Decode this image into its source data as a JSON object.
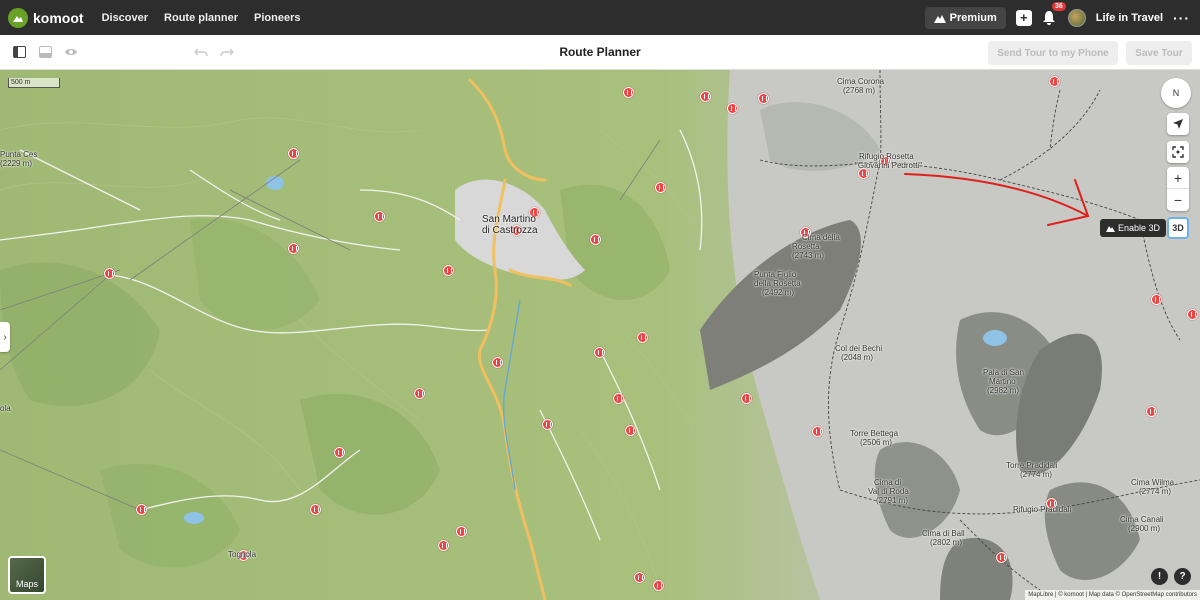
{
  "nav": {
    "logo_text": "komoot",
    "links": [
      "Discover",
      "Route planner",
      "Pioneers"
    ],
    "premium_label": "Premium",
    "notification_count": "36",
    "username": "Life in Travel",
    "more_label": "···"
  },
  "toolbar": {
    "title": "Route Planner",
    "send_label": "Send Tour to my Phone",
    "save_label": "Save Tour"
  },
  "map": {
    "scale_label": "500 m",
    "compass_label": "N",
    "zoom_in": "+",
    "zoom_out": "−",
    "enable3d_label": "Enable 3D",
    "btn3d_label": "3D",
    "maps_label": "Maps",
    "info_label": "!",
    "help_label": "?",
    "attribution": "MapLibre | © komoot | Map data © OpenStreetMap contributors",
    "labels": {
      "town": "San Martino di Castrozza",
      "town_line1": "San Martino",
      "town_line2": "di Castrozza",
      "punta_ces_name": "Punta Ces",
      "punta_ces_alt": "(2229 m)",
      "cima_corona_name": "Cima Corona",
      "cima_corona_alt": "(2768 m)",
      "rifugio_rosetta_line1": "Rifugio Rosetta",
      "rifugio_rosetta_line2": "\"Giovanni Pedrotti\"",
      "cima_rosetta_line1": "Cima della",
      "cima_rosetta_line2": "Rosetta",
      "cima_rosetta_alt": "(2743 m)",
      "punta_figlio_line1": "Punta Figlio",
      "punta_figlio_line2": "della Rosetta",
      "punta_figlio_alt": "(2492 m)",
      "col_bechi_name": "Col dei Bechi",
      "col_bechi_alt": "(2048 m)",
      "pala_line1": "Pala di San",
      "pala_line2": "Martino",
      "pala_alt": "(2982 m)",
      "torre_bettega_name": "Torre Bettega",
      "torre_bettega_alt": "(2506 m)",
      "torre_pradidali_name": "Torre Pradidali",
      "torre_pradidali_alt": "(2774 m)",
      "cima_val_line1": "Cima di",
      "cima_val_line2": "Val di Roda",
      "cima_val_alt": "(2791 m)",
      "rifugio_pradidali": "Rifugio Pradidali",
      "cima_wilma_name": "Cima Wilma",
      "cima_wilma_alt": "(2774 m)",
      "cima_canali_name": "Cima Canali",
      "cima_canali_alt": "(2900 m)",
      "cima_ball_name": "Cima di Ball",
      "cima_ball_alt": "(2802 m)",
      "tognola": "Tognola",
      "ola": "ola"
    }
  },
  "colors": {
    "nav_bg": "#2d2d2d",
    "brand_green": "#6aa127",
    "poi_red": "#e44444",
    "road_yellow": "#f0c060",
    "annotation_red": "#e0201c"
  }
}
